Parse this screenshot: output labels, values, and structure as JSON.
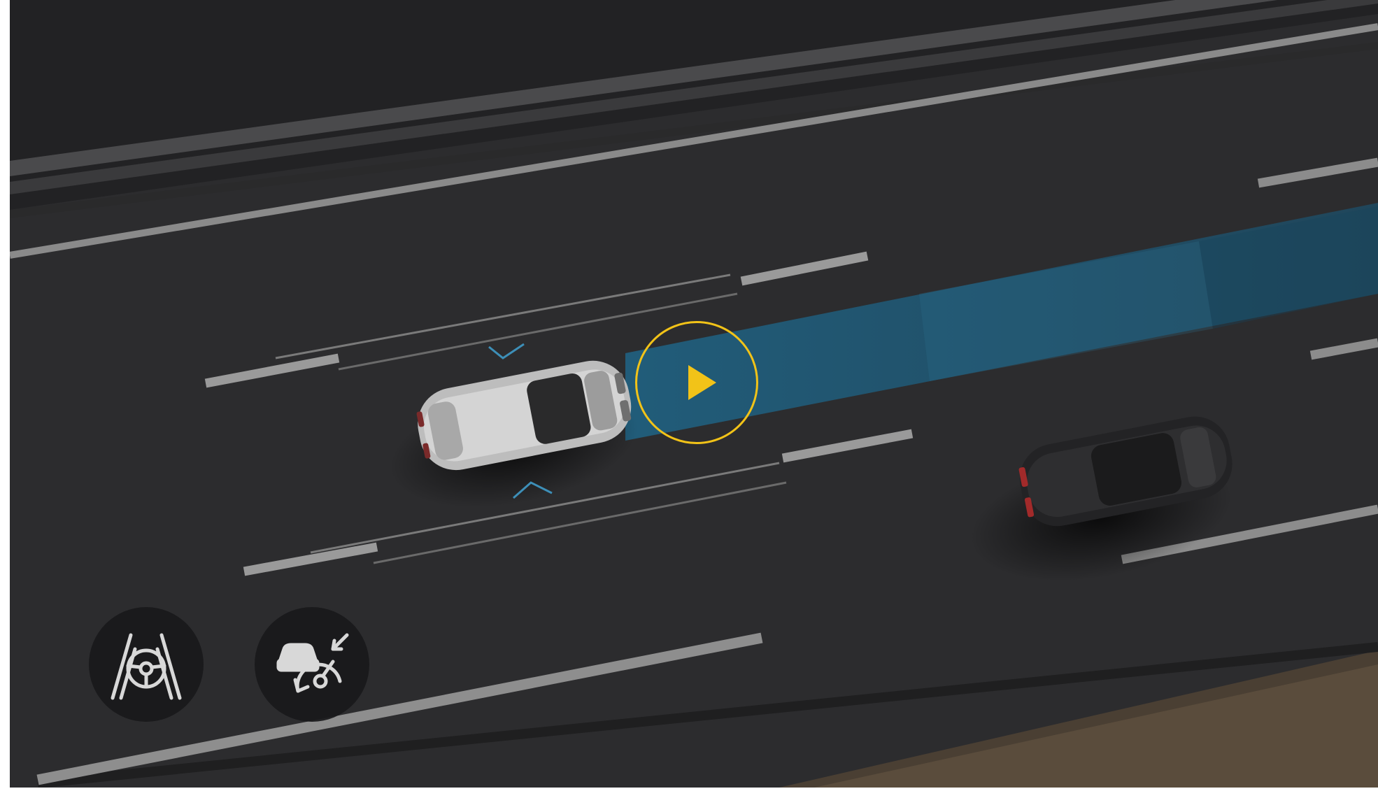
{
  "video": {
    "state": "paused",
    "play_icon": "play-icon",
    "accent_color": "#f2c318",
    "detection_zone_color": "#1f5f80"
  },
  "feature_icons": [
    {
      "icon": "lane-keeping-assist-icon"
    },
    {
      "icon": "adaptive-cruise-control-icon"
    }
  ]
}
